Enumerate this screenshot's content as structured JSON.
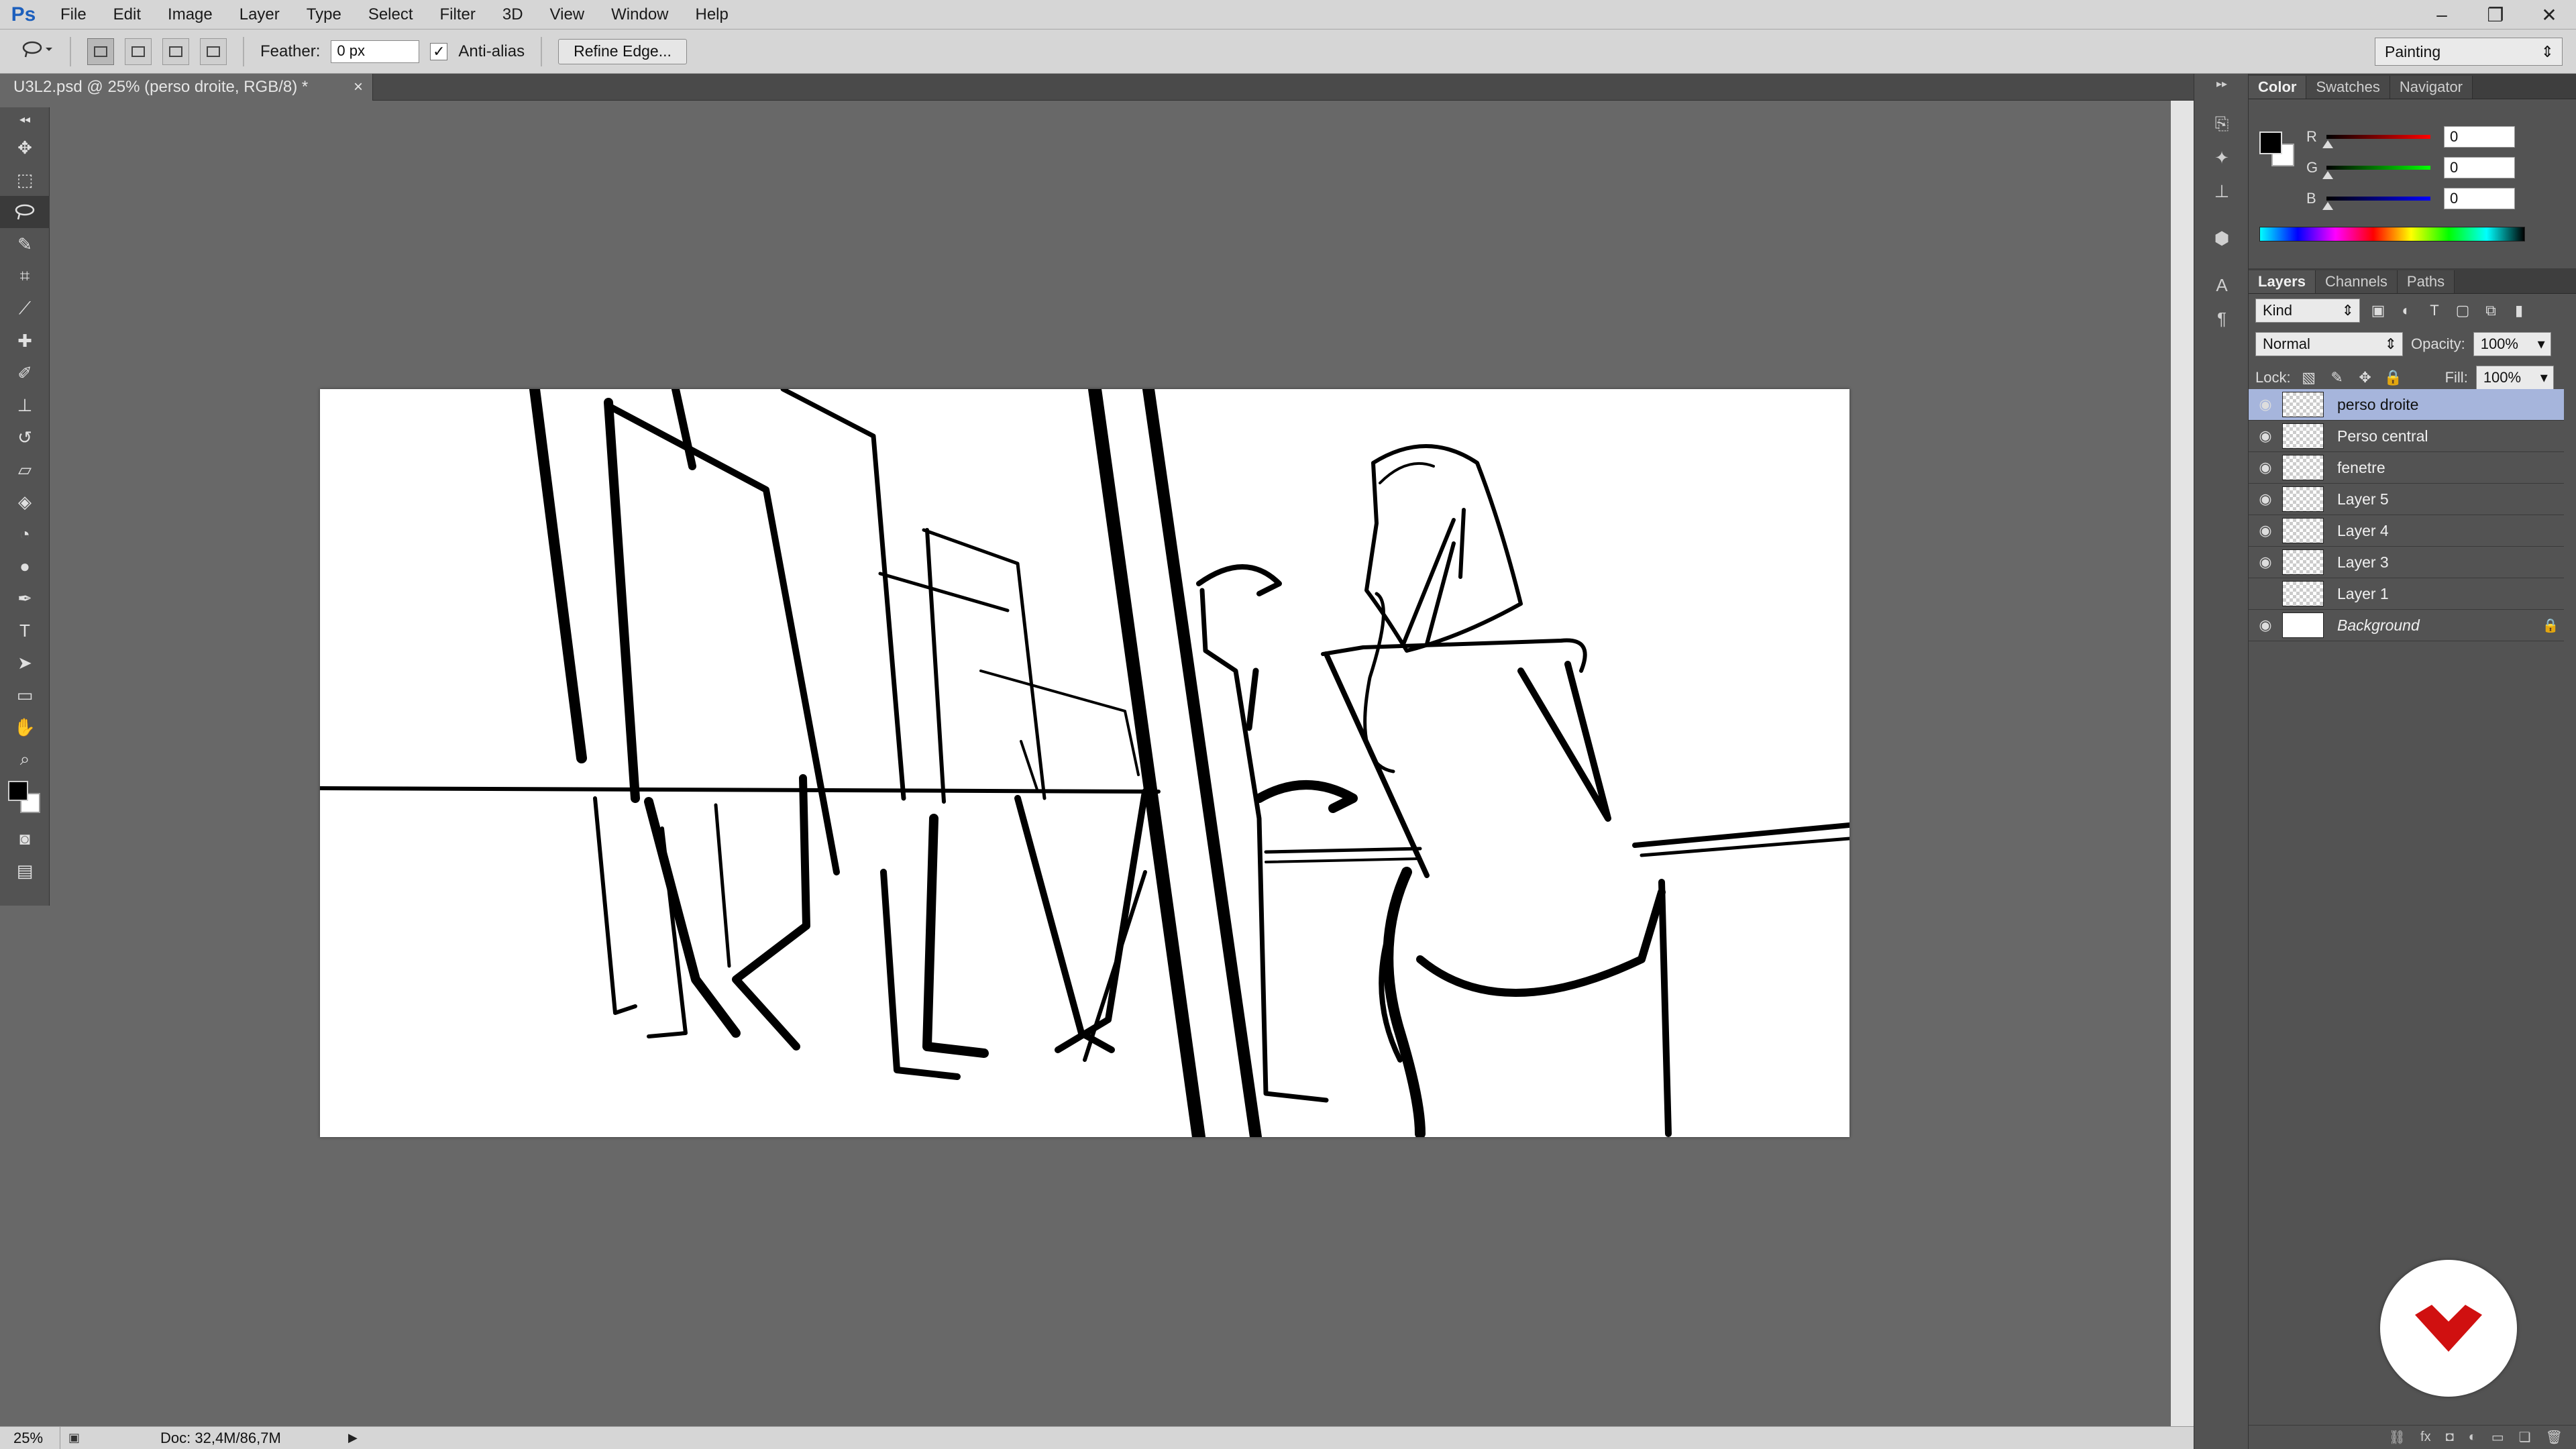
{
  "app": {
    "logo": "Ps",
    "menu": [
      "File",
      "Edit",
      "Image",
      "Layer",
      "Type",
      "Select",
      "Filter",
      "3D",
      "View",
      "Window",
      "Help"
    ]
  },
  "options": {
    "feather_label": "Feather:",
    "feather_value": "0 px",
    "antialias_label": "Anti-alias",
    "antialias_check": "✓",
    "refine_edge": "Refine Edge...",
    "workspace": "Painting"
  },
  "document": {
    "tab_title": "U3L2.psd @ 25% (perso droite, RGB/8) *",
    "close": "×"
  },
  "status": {
    "zoom": "25%",
    "doc_info": "Doc: 32,4M/86,7M",
    "arrow": "▶"
  },
  "color_panel": {
    "tabs": [
      "Color",
      "Swatches",
      "Navigator"
    ],
    "channels": [
      {
        "label": "R",
        "value": "0",
        "color": "#e01010"
      },
      {
        "label": "G",
        "value": "0",
        "color": "#10c010"
      },
      {
        "label": "B",
        "value": "0",
        "color": "#1010e0"
      }
    ]
  },
  "layers_panel": {
    "tabs": [
      "Layers",
      "Channels",
      "Paths"
    ],
    "kind": "Kind",
    "blend_mode": "Normal",
    "opacity_label": "Opacity:",
    "opacity_value": "100%",
    "lock_label": "Lock:",
    "fill_label": "Fill:",
    "fill_value": "100%",
    "layers": [
      {
        "name": "perso droite",
        "visible": true,
        "selected": true
      },
      {
        "name": "Perso central",
        "visible": true,
        "selected": false
      },
      {
        "name": "fenetre",
        "visible": true,
        "selected": false
      },
      {
        "name": "Layer 5",
        "visible": true,
        "selected": false
      },
      {
        "name": "Layer 4",
        "visible": true,
        "selected": false
      },
      {
        "name": "Layer 3",
        "visible": true,
        "selected": false
      },
      {
        "name": "Layer 1",
        "visible": false,
        "selected": false
      },
      {
        "name": "Background",
        "visible": true,
        "selected": false,
        "locked": true
      }
    ]
  },
  "colors": {
    "badge_red": "#d01010",
    "selected_layer": "#a6b5dc"
  }
}
